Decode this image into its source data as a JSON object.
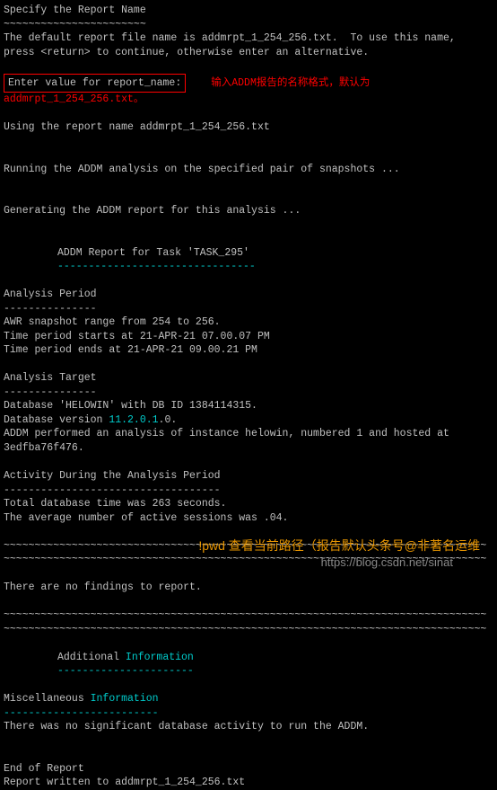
{
  "heading": "Specify the Report Name",
  "heading_dashes": "~~~~~~~~~~~~~~~~~~~~~~~",
  "default_line": "The default report file name is addmrpt_1_254_256.txt.  To use this name,",
  "press_line": "press <return> to continue, otherwise enter an alternative.",
  "prompt": "Enter value for report_name:",
  "annotation": "输入ADDM报告的名称格式，默认为addmrpt_1_254_256.txt。",
  "using_line": "Using the report name addmrpt_1_254_256.txt",
  "running_line": "Running the ADDM analysis on the specified pair of snapshots ...",
  "generating_line": "Generating the ADDM report for this analysis ...",
  "report_header": "ADDM Report for Task 'TASK_295'",
  "report_header_dash": "--------------------------------",
  "analysis_period": "Analysis Period",
  "ap_dash": "---------------",
  "awr_range": "AWR snapshot range from 254 to 256.",
  "time_start": "Time period starts at 21-APR-21 07.00.07 PM",
  "time_end": "Time period ends at 21-APR-21 09.00.21 PM",
  "analysis_target": "Analysis Target",
  "at_dash": "---------------",
  "db_line": "Database 'HELOWIN' with DB ID 1384114315.",
  "db_version_pre": "Database version ",
  "db_version_ver": "11.2.0.1",
  "db_version_post": ".0.",
  "addm_instance": "ADDM performed an analysis of instance helowin, numbered 1 and hosted at",
  "addm_host": "3edfba76f476.",
  "activity_period": "Activity During the Analysis Period",
  "activity_dash": "-----------------------------------",
  "total_db_time": "Total database time was 263 seconds.",
  "avg_sessions": "The average number of active sessions was .04.",
  "tilde_line": "~~~~~~~~~~~~~~~~~~~~~~~~~~~~~~~~~~~~~~~~~~~~~~~~~~~~~~~~~~~~~~~~~~~~~~~~~~~~~~",
  "no_findings": "There are no findings to report.",
  "additional_pre": "Additional ",
  "additional_info": "Information",
  "additional_dash": "----------------------",
  "misc_pre": "Miscellaneous ",
  "misc_info": "Information",
  "misc_dash": "-------------------------",
  "no_activity": "There was no significant database activity to run the ADDM.",
  "end_report": "End of Report",
  "report_written": "Report written to addmrpt_1_254_256.txt",
  "watermark_orange": "!pwd 查看当前路径（报告默认头条号@非著名运维",
  "watermark_url": "https://blog.csdn.net/sinat"
}
